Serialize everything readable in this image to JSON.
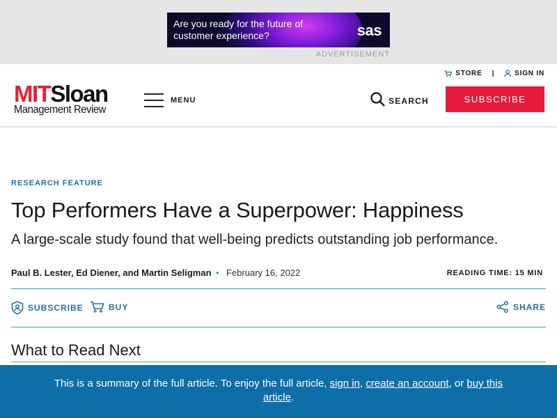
{
  "ad": {
    "text": "Are you ready for the future of customer experience?",
    "logo": "sas",
    "label": "ADVERTISEMENT"
  },
  "header": {
    "store_label": "STORE",
    "signin_label": "SIGN IN",
    "separator": "|",
    "logo_top_mit": "MIT",
    "logo_top_sloan": "Sloan",
    "logo_bottom": "Management Review",
    "menu_label": "MENU",
    "search_label": "SEARCH",
    "subscribe_label": "SUBSCRIBE"
  },
  "article": {
    "kicker": "RESEARCH FEATURE",
    "title": "Top Performers Have a Superpower: Happiness",
    "dek": "A large-scale study found that well-being predicts outstanding job performance.",
    "authors": "Paul B. Lester, Ed Diener, and Martin Seligman",
    "dot": "•",
    "date": "February 16, 2022",
    "reading_time": "READING TIME: 15 MIN"
  },
  "actions": {
    "subscribe": "SUBSCRIBE",
    "buy": "BUY",
    "share": "SHARE"
  },
  "read_next": {
    "heading": "What to Read Next"
  },
  "notice": {
    "prefix": "This is a summary of the full article. To enjoy the full article, ",
    "link_signin": "sign in",
    "sep1": ", ",
    "link_create": "create an account",
    "sep2": ", or ",
    "link_buy": "buy this article",
    "suffix": "."
  },
  "colors": {
    "brand_red": "#e61a3a",
    "accent_blue": "#1f6fa8",
    "notice_blue": "#0e6ea8",
    "rule_teal": "#1fa6c9"
  },
  "icons": {
    "store": "cart-icon",
    "signin": "user-icon",
    "menu": "hamburger-icon",
    "search": "search-icon",
    "subscribe": "shield-user-icon",
    "buy": "cart-icon",
    "share": "share-icon"
  }
}
